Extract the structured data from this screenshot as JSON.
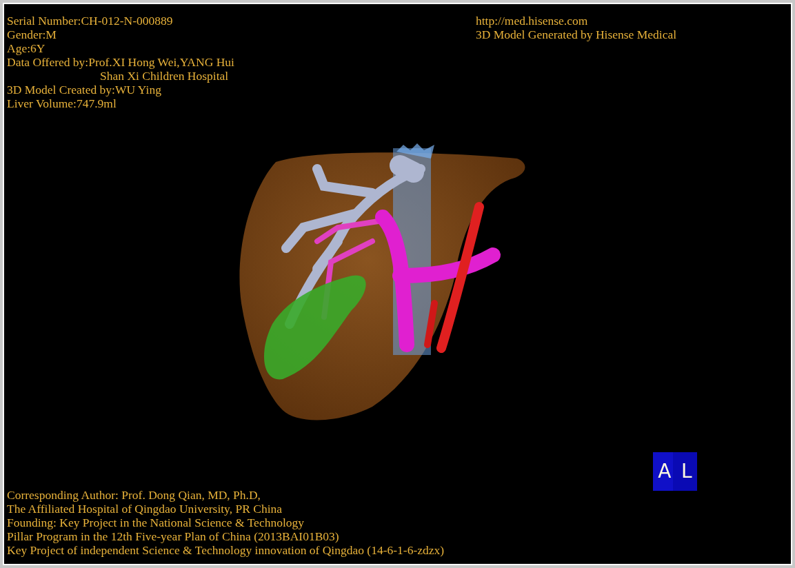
{
  "info_lines": [
    {
      "kind": "line",
      "text": "Serial Number:CH-012-N-000889"
    },
    {
      "kind": "line",
      "text": "Gender:M"
    },
    {
      "kind": "line",
      "text": "Age:6Y"
    },
    {
      "kind": "line",
      "text": "Data Offered by:Prof.XI Hong Wei,YANG Hui"
    },
    {
      "kind": "continuation",
      "text": "Shan Xi Children Hospital"
    },
    {
      "kind": "line",
      "text": "3D Model Created by:WU Ying"
    },
    {
      "kind": "line",
      "text": "Liver Volume:747.9ml"
    }
  ],
  "site": {
    "url": "http://med.hisense.com",
    "generator": "3D Model Generated by Hisense Medical"
  },
  "orientation_cube": {
    "labels": [
      "A",
      "L"
    ]
  },
  "credit_lines": [
    "Corresponding Author: Prof. Dong Qian, MD, Ph.D,",
    "The Affiliated Hospital of Qingdao University, PR China",
    "Founding: Key Project in the National Science & Technology",
    "Pillar Program in the 12th Five-year Plan of China (2013BAI01B03)",
    "Key Project of independent Science & Technology innovation of Qingdao (14-6-1-6-zdzx)"
  ]
}
